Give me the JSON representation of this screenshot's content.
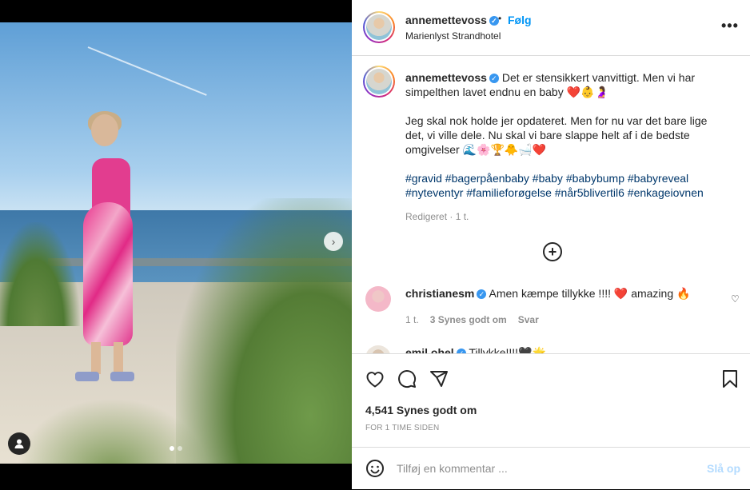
{
  "header": {
    "username": "annemettevoss",
    "separator": "•",
    "follow_label": "Følg",
    "location": "Marienlyst Strandhotel",
    "more_label": "•••"
  },
  "caption": {
    "username": "annemettevoss",
    "line1": "Det er stensikkert vanvittigt. Men vi har simpelthen lavet endnu en baby",
    "line1_emoji": "❤️👶🤰",
    "para2": "Jeg skal nok holde jer opdateret. Men for nu var det bare lige det, vi ville dele. Nu skal vi bare slappe helt af i de bedste omgivelser",
    "para2_emoji": "🌊🌸🏆🐥🛁❤️",
    "hashtags": "#gravid #bagerpåenbaby #baby #babybump #babyreveal #nyteventyr #familieforøgelse #når5blivertil6 #enkageiovnen",
    "meta": "Redigeret · 1 t."
  },
  "comments": [
    {
      "username": "christianesm",
      "text": "Amen kæmpe tillykke !!!! ❤️ amazing 🔥",
      "time": "1 t.",
      "likes": "3 Synes godt om",
      "reply": "Svar"
    },
    {
      "username": "emil.ohel",
      "text": "Tillykke!!!!🖤🌟"
    }
  ],
  "actions": {
    "likes": "4,541 Synes godt om",
    "time": "FOR 1 TIME SIDEN"
  },
  "comment_box": {
    "placeholder": "Tilføj en kommentar ...",
    "post_label": "Slå op"
  },
  "media": {
    "arrow": "›"
  },
  "icons": [
    "verified-badge-icon",
    "more-options-icon",
    "plus-circle-icon",
    "heart-icon",
    "comment-icon",
    "share-icon",
    "bookmark-icon",
    "emoji-icon",
    "tag-user-icon",
    "next-arrow-icon"
  ],
  "colors": {
    "link_blue": "#0095f6",
    "hashtag": "#00376b",
    "muted": "#8e8e8e",
    "post_disabled": "#b3dbff"
  }
}
